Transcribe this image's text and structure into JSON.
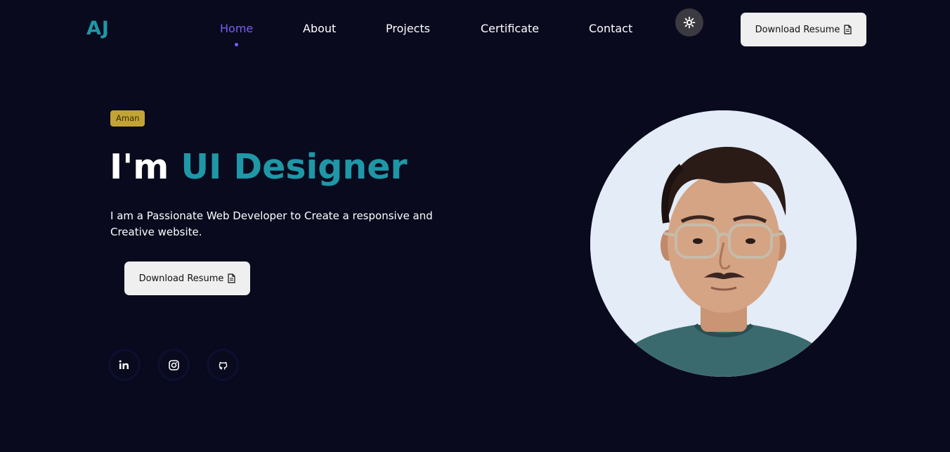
{
  "header": {
    "logo": "AJ",
    "nav": [
      {
        "label": "Home"
      },
      {
        "label": "About"
      },
      {
        "label": "Projects"
      },
      {
        "label": "Certificate"
      },
      {
        "label": "Contact"
      }
    ],
    "theme_toggle_icon": "sun-icon",
    "download_label": "Download Resume",
    "download_icon": "document-icon"
  },
  "hero": {
    "badge": "Aman",
    "headline_prefix": "I'm",
    "headline_role": "UI Designer",
    "intro": "I am a Passionate Web Developer to Create a responsive and Creative website.",
    "download_label": "Download Resume",
    "download_icon": "document-icon",
    "socials": [
      {
        "icon": "linkedin-icon"
      },
      {
        "icon": "instagram-icon"
      },
      {
        "icon": "github-icon"
      }
    ],
    "avatar_icon": "profile-photo"
  },
  "colors": {
    "background": "#090a1e",
    "accent_teal": "#1f97a6",
    "accent_purple": "#7a5cf0",
    "badge": "#c2a436",
    "button": "#efefef"
  }
}
